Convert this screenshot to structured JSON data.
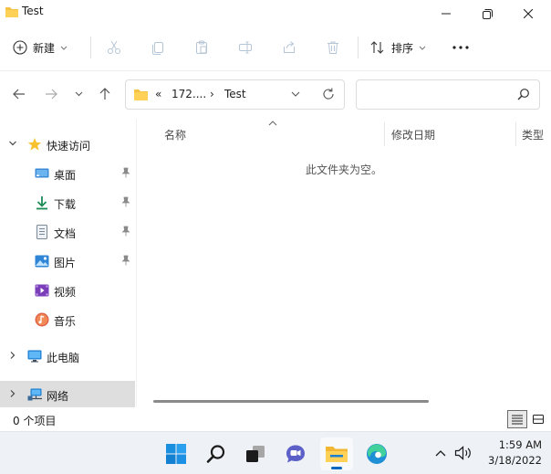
{
  "window": {
    "title": "Test"
  },
  "toolbar": {
    "new_label": "新建",
    "sort_label": "排序",
    "more_label": "..."
  },
  "address": {
    "overflow": "«",
    "crumb1": "172....",
    "sep": "›",
    "crumb2": "Test"
  },
  "search": {
    "placeholder": ""
  },
  "sidebar": {
    "items": [
      {
        "label": "快速访问",
        "icon": "star-icon"
      },
      {
        "label": "桌面",
        "icon": "desktop-icon",
        "pinned": true
      },
      {
        "label": "下载",
        "icon": "download-icon",
        "pinned": true
      },
      {
        "label": "文档",
        "icon": "document-icon",
        "pinned": true
      },
      {
        "label": "图片",
        "icon": "picture-icon",
        "pinned": true
      },
      {
        "label": "视频",
        "icon": "video-icon"
      },
      {
        "label": "音乐",
        "icon": "music-icon"
      },
      {
        "label": "此电脑",
        "icon": "computer-icon"
      },
      {
        "label": "网络",
        "icon": "network-icon"
      }
    ]
  },
  "columns": {
    "name": "名称",
    "modified": "修改日期",
    "type": "类型"
  },
  "content": {
    "empty_message": "此文件夹为空。"
  },
  "status": {
    "count": "0 个项目"
  },
  "taskbar": {
    "clock_time": "1:59 AM",
    "clock_date": "3/18/2022"
  },
  "colors": {
    "accent": "#0067c0",
    "folder": "#f6c244",
    "selection": "#dedede"
  }
}
